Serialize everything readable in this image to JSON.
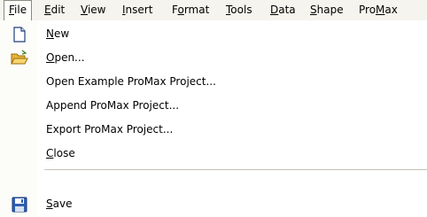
{
  "menubar": {
    "items": [
      {
        "label": "File",
        "accel": "F",
        "rest": "ile"
      },
      {
        "label": "Edit",
        "accel": "E",
        "rest": "dit"
      },
      {
        "label": "View",
        "accel": "V",
        "rest": "iew"
      },
      {
        "label": "Insert",
        "accel": "I",
        "rest": "nsert"
      },
      {
        "label": "Format",
        "pre": "F",
        "accel": "o",
        "rest": "rmat"
      },
      {
        "label": "Tools",
        "accel": "T",
        "rest": "ools"
      },
      {
        "label": "Data",
        "accel": "D",
        "rest": "ata"
      },
      {
        "label": "Shape",
        "accel": "S",
        "rest": "hape"
      },
      {
        "label": "ProMax",
        "pre": "Pro",
        "accel": "M",
        "rest": "ax"
      }
    ]
  },
  "file_menu": {
    "items": [
      {
        "label": "New",
        "accel": "N",
        "rest": "ew",
        "icon": "new-document-icon"
      },
      {
        "label": "Open...",
        "accel": "O",
        "rest": "pen...",
        "icon": "open-folder-icon"
      },
      {
        "label": "Open Example ProMax Project...",
        "accel": "",
        "rest": "Open Example ProMax Project..."
      },
      {
        "label": "Append ProMax Project...",
        "accel": "",
        "rest": "Append ProMax Project..."
      },
      {
        "label": "Export ProMax Project...",
        "accel": "",
        "rest": "Export ProMax Project..."
      },
      {
        "label": "Close",
        "accel": "C",
        "rest": "lose"
      },
      {
        "label": "Save",
        "accel": "S",
        "rest": "ave",
        "icon": "save-disk-icon"
      }
    ]
  }
}
